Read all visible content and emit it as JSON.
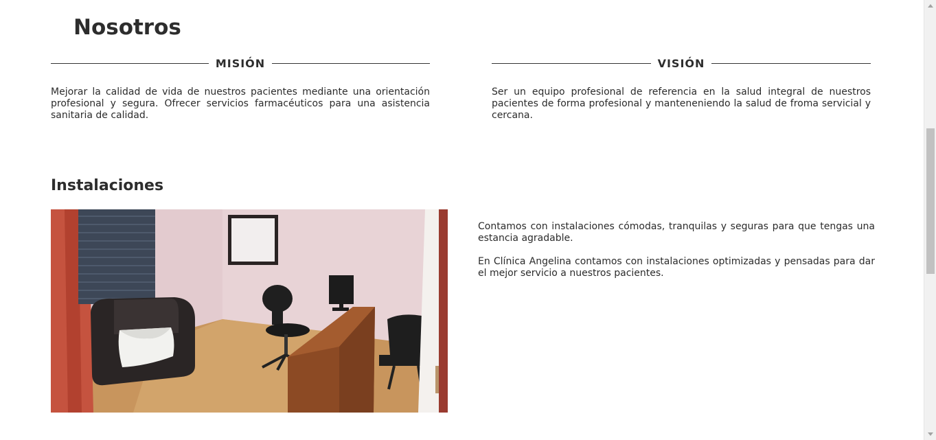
{
  "about": {
    "title": "Nosotros",
    "mission": {
      "label": "MISIÓN",
      "text": "Mejorar la calidad de vida de nuestros pacientes mediante una orientación profesional y segura. Ofrecer servicios farmacéuticos para una asistencia sanitaria de calidad."
    },
    "vision": {
      "label": "VISIÓN",
      "text": "Ser un equipo profesional de referencia en la salud integral de nuestros pacientes de forma profesional y manteneniendo la salud de froma servicial y cercana."
    }
  },
  "installations": {
    "title": "Instalaciones",
    "paragraphs": [
      "Contamos con instalaciones cómodas, tranquilas y seguras para que tengas una estancia agradable.",
      "En Clínica Angelina contamos con instalaciones optimizadas y pensadas para dar el mejor servicio a nuestros pacientes."
    ]
  },
  "colors": {
    "text": "#2b2b2b",
    "heading": "#2d2d2d",
    "divider": "#333333",
    "background": "#ffffff"
  }
}
